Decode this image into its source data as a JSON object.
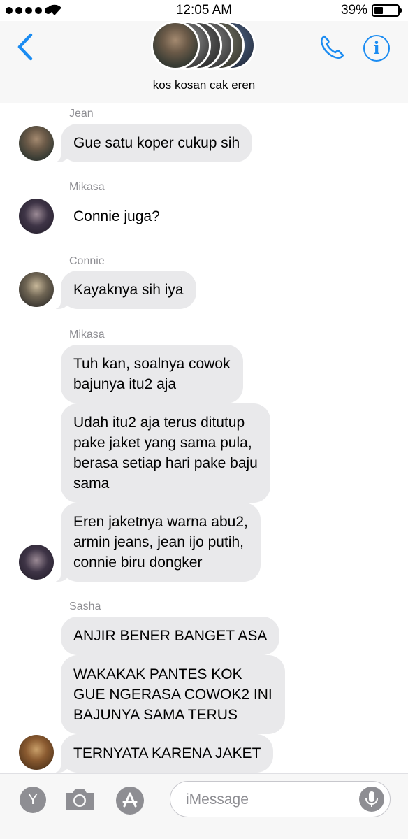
{
  "status_bar": {
    "time": "12:05 AM",
    "battery_percent": "39%",
    "battery_level": 0.39,
    "signal_bars": 5
  },
  "header": {
    "group_name": "kos kosan cak eren",
    "back_icon": "chevron-left-icon",
    "call_icon": "phone-icon",
    "info_icon": "info-icon",
    "info_label": "i",
    "accent_color": "#1b8cf2"
  },
  "messages": [
    {
      "sender": "Jean",
      "bubbles": [
        "Gue satu koper cukup sih"
      ]
    },
    {
      "sender": "Mikasa",
      "bubbles": [
        "Connie juga?"
      ]
    },
    {
      "sender": "Connie",
      "bubbles": [
        "Kayaknya sih iya"
      ]
    },
    {
      "sender": "Mikasa",
      "bubbles": [
        "Tuh kan, soalnya cowok\nbajunya itu2 aja",
        "Udah itu2 aja terus ditutup\npake jaket yang sama pula,\nberasa setiap hari pake baju\nsama",
        "Eren jaketnya warna abu2,\narmin jeans, jean ijo putih,\nconnie biru dongker"
      ]
    },
    {
      "sender": "Sasha",
      "bubbles": [
        "ANJIR BENER BANGET ASA",
        "WAKAKAK PANTES KOK\nGUE NGERASA COWOK2 INI\nBAJUNYA SAMA TERUS",
        "TERNYATA KARENA JAKET"
      ]
    }
  ],
  "input_bar": {
    "y_label": "Y",
    "placeholder": "iMessage",
    "camera_icon": "camera-icon",
    "appstore_icon": "app-store-icon",
    "mic_icon": "microphone-icon"
  },
  "colors": {
    "incoming_bubble": "#e9e9eb",
    "sender_label": "#8e8e93"
  }
}
